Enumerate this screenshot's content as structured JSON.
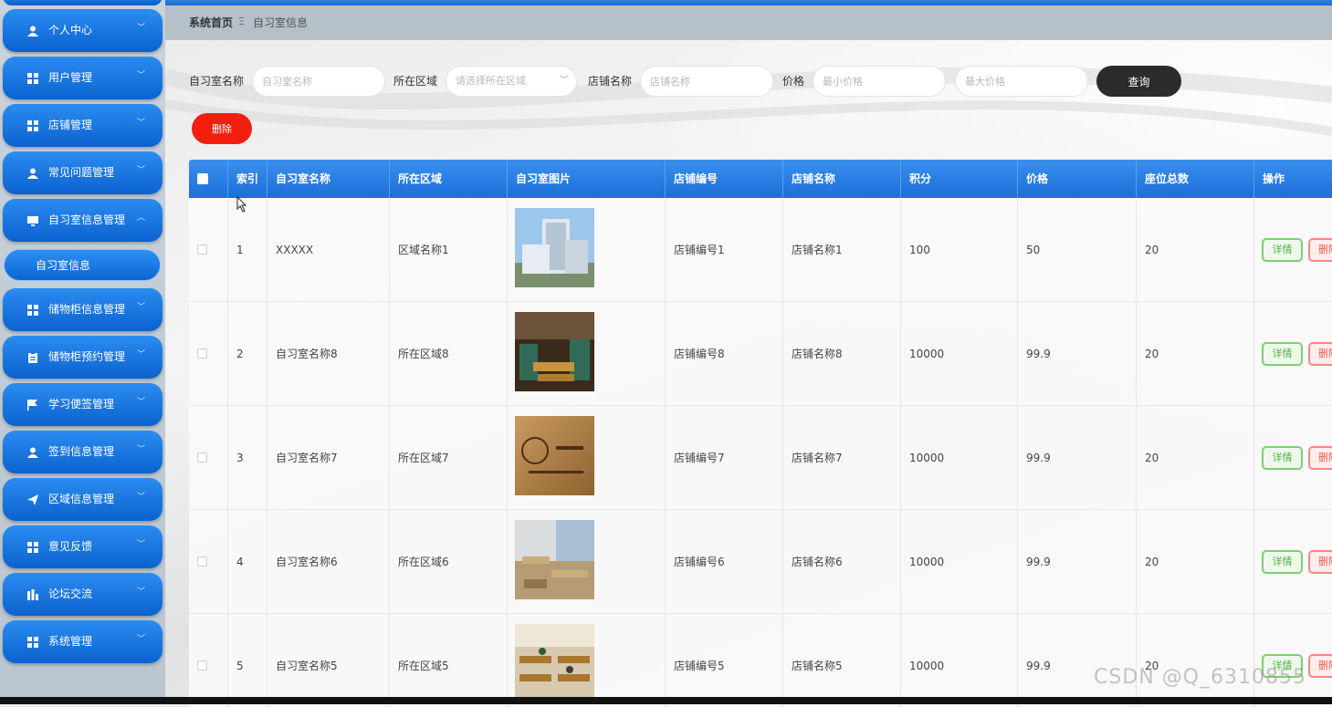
{
  "sidebar": {
    "items": [
      {
        "label": "个人中心",
        "icon": "person-icon"
      },
      {
        "label": "用户管理",
        "icon": "grid-icon"
      },
      {
        "label": "店铺管理",
        "icon": "grid-icon"
      },
      {
        "label": "常见问题管理",
        "icon": "person-icon"
      },
      {
        "label": "自习室信息管理",
        "icon": "monitor-icon"
      },
      {
        "label": "储物柜信息管理",
        "icon": "grid-icon"
      },
      {
        "label": "储物柜预约管理",
        "icon": "clipboard-icon"
      },
      {
        "label": "学习便签管理",
        "icon": "flag-icon"
      },
      {
        "label": "签到信息管理",
        "icon": "person-icon"
      },
      {
        "label": "区域信息管理",
        "icon": "send-icon"
      },
      {
        "label": "意见反馈",
        "icon": "grid-icon"
      },
      {
        "label": "论坛交流",
        "icon": "bar-chart-icon"
      },
      {
        "label": "系统管理",
        "icon": "grid-icon"
      }
    ],
    "active_sub": "自习室信息"
  },
  "breadcrumb": {
    "home": "系统首页",
    "separator": "Ξ",
    "current": "自习室信息"
  },
  "search": {
    "name_label": "自习室名称",
    "name_placeholder": "自习室名称",
    "region_label": "所在区域",
    "region_placeholder": "请选择所在区域",
    "shop_label": "店铺名称",
    "shop_placeholder": "店铺名称",
    "price_label": "价格",
    "min_placeholder": "最小价格",
    "max_placeholder": "最大价格",
    "query_button": "查询"
  },
  "toolbar": {
    "delete_button": "删除"
  },
  "table": {
    "headers": [
      "索引",
      "自习室名称",
      "所在区域",
      "自习室图片",
      "店铺编号",
      "店铺名称",
      "积分",
      "价格",
      "座位总数",
      "操作"
    ],
    "rows": [
      {
        "index": "1",
        "name": "XXXXX",
        "region": "区域名称1",
        "image": "office-building",
        "shop_no": "店铺编号1",
        "shop_name": "店铺名称1",
        "points": "100",
        "price": "50",
        "seats": "20"
      },
      {
        "index": "2",
        "name": "自习室名称8",
        "region": "所在区域8",
        "image": "cafe-study-room",
        "shop_no": "店铺编号8",
        "shop_name": "店铺名称8",
        "points": "10000",
        "price": "99.9",
        "seats": "20"
      },
      {
        "index": "3",
        "name": "自习室名称7",
        "region": "所在区域7",
        "image": "wooden-sign-room",
        "shop_no": "店铺编号7",
        "shop_name": "店铺名称7",
        "points": "10000",
        "price": "99.9",
        "seats": "20"
      },
      {
        "index": "4",
        "name": "自习室名称6",
        "region": "所在区域6",
        "image": "desk-room",
        "shop_no": "店铺编号6",
        "shop_name": "店铺名称6",
        "points": "10000",
        "price": "99.9",
        "seats": "20"
      },
      {
        "index": "5",
        "name": "自习室名称5",
        "region": "所在区域5",
        "image": "classroom",
        "shop_no": "店铺编号5",
        "shop_name": "店铺名称5",
        "points": "10000",
        "price": "99.9",
        "seats": "20"
      }
    ],
    "detail_button": "详情",
    "delete_button": "删除"
  },
  "watermark": "CSDN @Q_6310855",
  "colors": {
    "primary": "#1b6fd9",
    "danger": "#f31f0e",
    "dark_button": "#2b2b2b",
    "success": "#52b241"
  }
}
